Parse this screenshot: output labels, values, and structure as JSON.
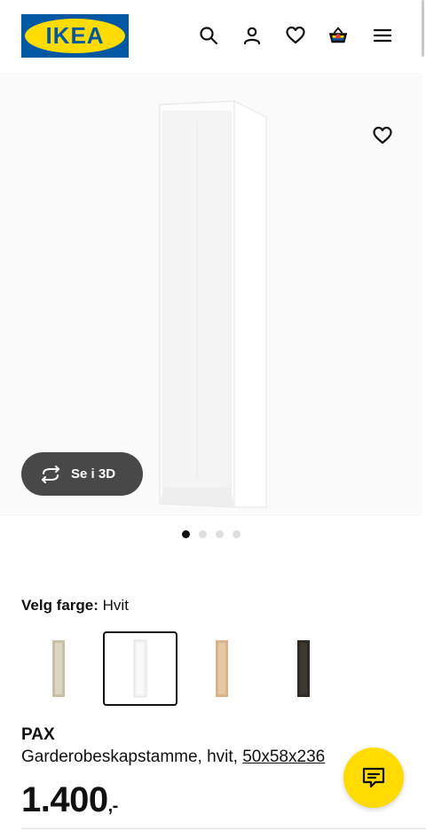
{
  "header": {
    "logo_text": "IKEA",
    "icons": [
      "search-icon",
      "user-icon",
      "heart-icon",
      "basket-icon",
      "menu-icon"
    ]
  },
  "gallery": {
    "view_3d_label": "Se i 3D",
    "slide_count": 4,
    "active_slide": 1
  },
  "color_picker": {
    "label": "Velg farge:",
    "value": "Hvit",
    "swatches": [
      {
        "name": "beige",
        "color": "#c9bfa9"
      },
      {
        "name": "white",
        "color": "#f2f2f2"
      },
      {
        "name": "oak",
        "color": "#d7b48c"
      },
      {
        "name": "black-brown",
        "color": "#2f2a26"
      }
    ],
    "selected_index": 1
  },
  "product": {
    "name": "PAX",
    "description": "Garderobeskapstamme, hvit,",
    "size": "50x58x236",
    "price": "1.400",
    "price_suffix": ",-"
  },
  "colors": {
    "brand_blue": "#0058a3",
    "brand_yellow": "#ffdb00",
    "dark_button": "#484848"
  }
}
